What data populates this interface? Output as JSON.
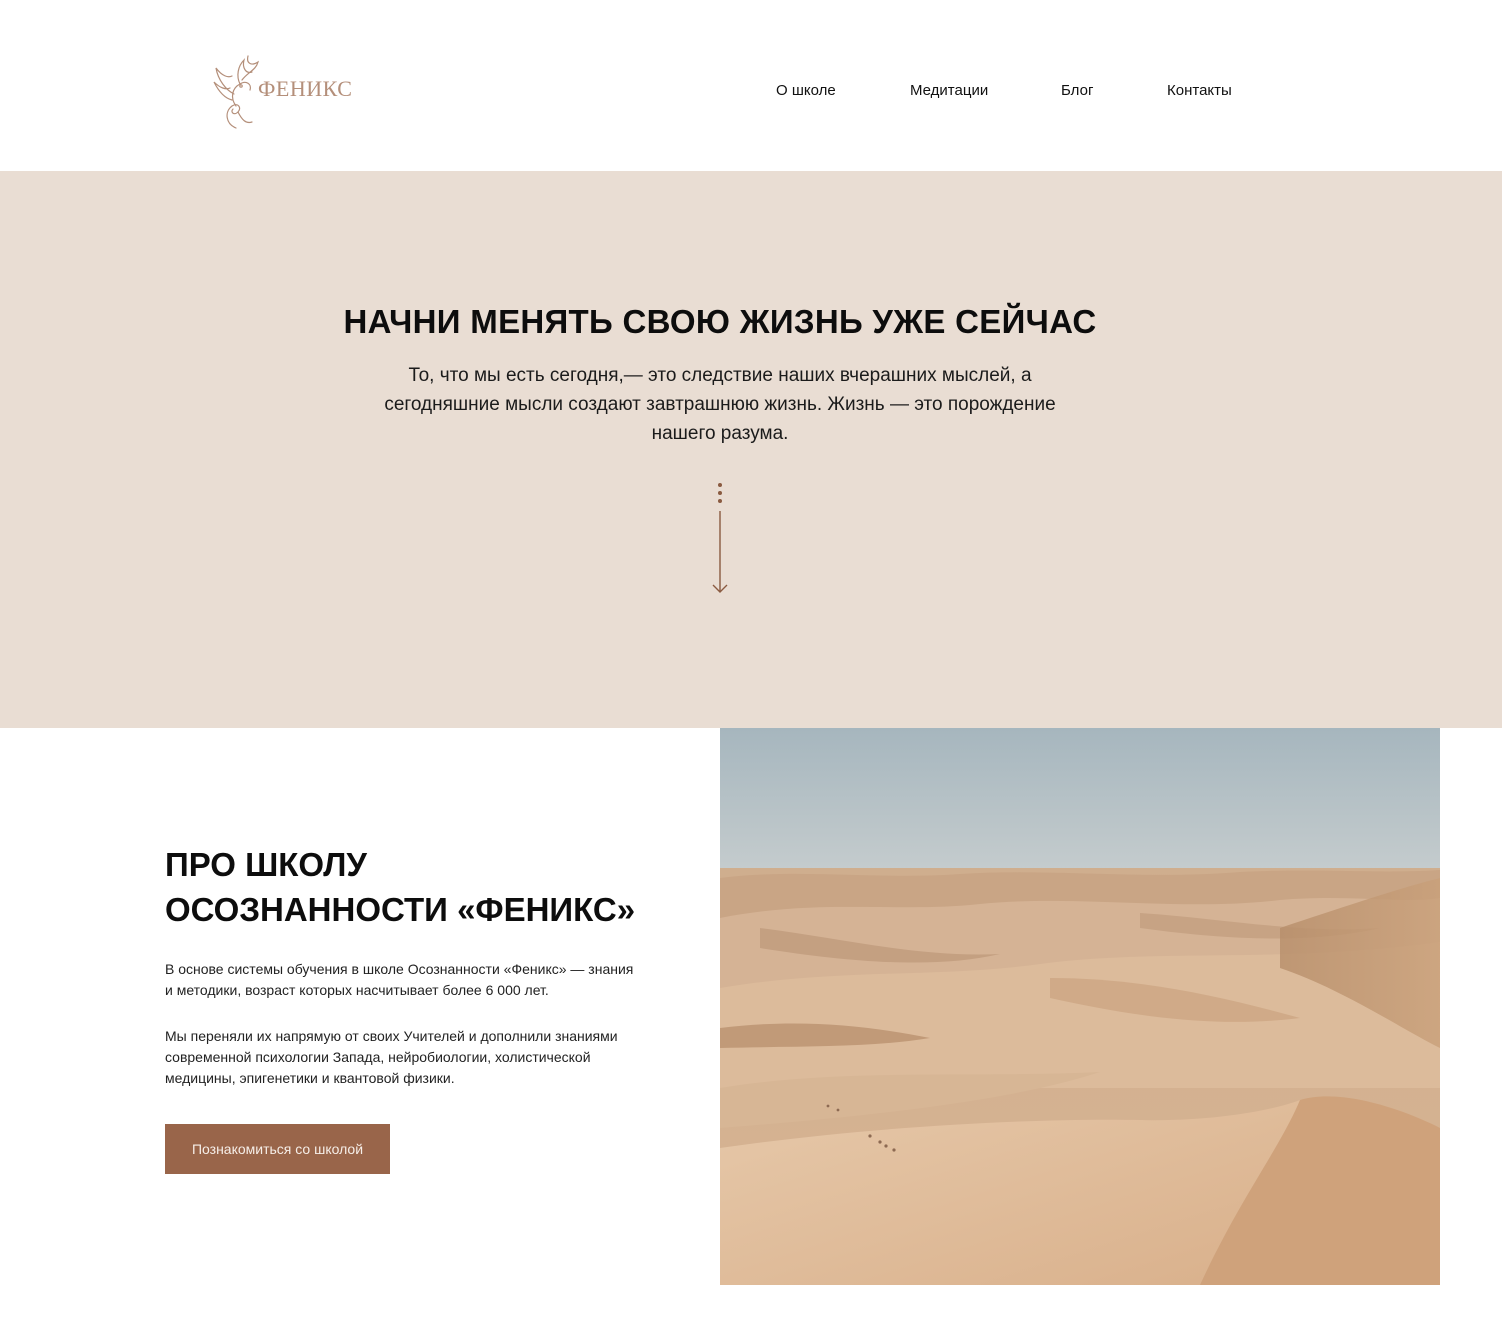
{
  "header": {
    "logo_text": "ФЕНИКС",
    "nav": [
      {
        "label": "О школе"
      },
      {
        "label": "Медитации"
      },
      {
        "label": "Блог"
      },
      {
        "label": "Контакты"
      }
    ]
  },
  "hero": {
    "title": "НАЧНИ МЕНЯТЬ СВОЮ ЖИЗНЬ УЖЕ СЕЙЧАС",
    "subtitle": "То, что мы есть сегодня,— это следствие наших вчерашних мыслей, а сегодняшние мысли создают завтрашнюю жизнь. Жизнь — это порождение нашего разума."
  },
  "about": {
    "title_line1": "ПРО ШКОЛУ",
    "title_line2": "ОСОЗНАННОСТИ «ФЕНИКС»",
    "paragraph1": "В основе системы обучения в школе Осознанности «Феникс» — знания и методики, возраст которых насчитывает более 6 000 лет.",
    "paragraph2": "Мы переняли их напрямую от своих Учителей и дополнили знаниями современной психологии Запада, нейробиологии, холистической медицины, эпигенетики и квантовой физики.",
    "button_label": "Познакомиться со школой"
  },
  "colors": {
    "hero_bg": "#e9ddd3",
    "accent": "#99654a",
    "logo": "#b48f7a"
  },
  "icons": {
    "logo": "phoenix-bird-icon",
    "scroll": "arrow-down-icon"
  }
}
